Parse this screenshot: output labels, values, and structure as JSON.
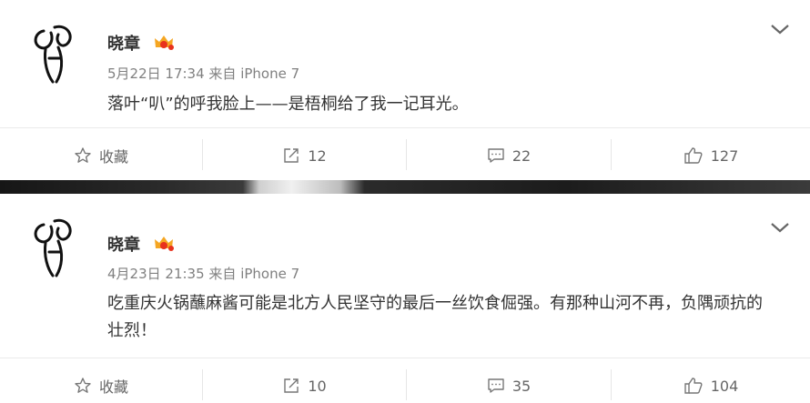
{
  "posts": [
    {
      "author": "晓章",
      "time": "5月22日 17:34",
      "source": "来自 iPhone 7",
      "text": "落叶“叭”的呼我脸上——是梧桐给了我一记耳光。",
      "actions": {
        "favorite_label": "收藏",
        "repost_count": "12",
        "comment_count": "22",
        "like_count": "127"
      }
    },
    {
      "author": "晓章",
      "time": "4月23日 21:35",
      "source": "来自 iPhone 7",
      "text": "吃重庆火锅蘸麻酱可能是北方人民坚守的最后一丝饮食倔强。有那种山河不再，负隅顽抗的壮烈！",
      "actions": {
        "favorite_label": "收藏",
        "repost_count": "10",
        "comment_count": "35",
        "like_count": "104"
      }
    }
  ],
  "colors": {
    "name": "#333333",
    "meta": "#808080",
    "action_text": "#666666",
    "border": "#eaeaea",
    "badge": "#f5a623"
  },
  "icons": [
    "avatar-logo",
    "vip-crown-badge",
    "chevron-down-icon",
    "star-icon",
    "repost-icon",
    "comment-icon",
    "like-icon"
  ]
}
